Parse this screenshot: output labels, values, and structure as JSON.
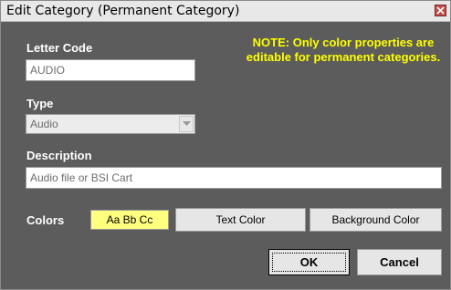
{
  "window": {
    "title": "Edit Category (Permanent Category)"
  },
  "form": {
    "letter_code_label": "Letter Code",
    "letter_code_value": "AUDIO",
    "type_label": "Type",
    "type_value": "Audio",
    "description_label": "Description",
    "description_value": "Audio file or BSI Cart",
    "note": "NOTE: Only color properties are editable for permanent categories."
  },
  "colors": {
    "label": "Colors",
    "preview_text": "Aa Bb Cc",
    "preview_background": "#ffff80",
    "text_color_button": "Text Color",
    "background_color_button": "Background Color"
  },
  "buttons": {
    "ok": "OK",
    "cancel": "Cancel"
  },
  "theme": {
    "panel_background": "#5c5c5c",
    "note_color": "#ffff00"
  }
}
